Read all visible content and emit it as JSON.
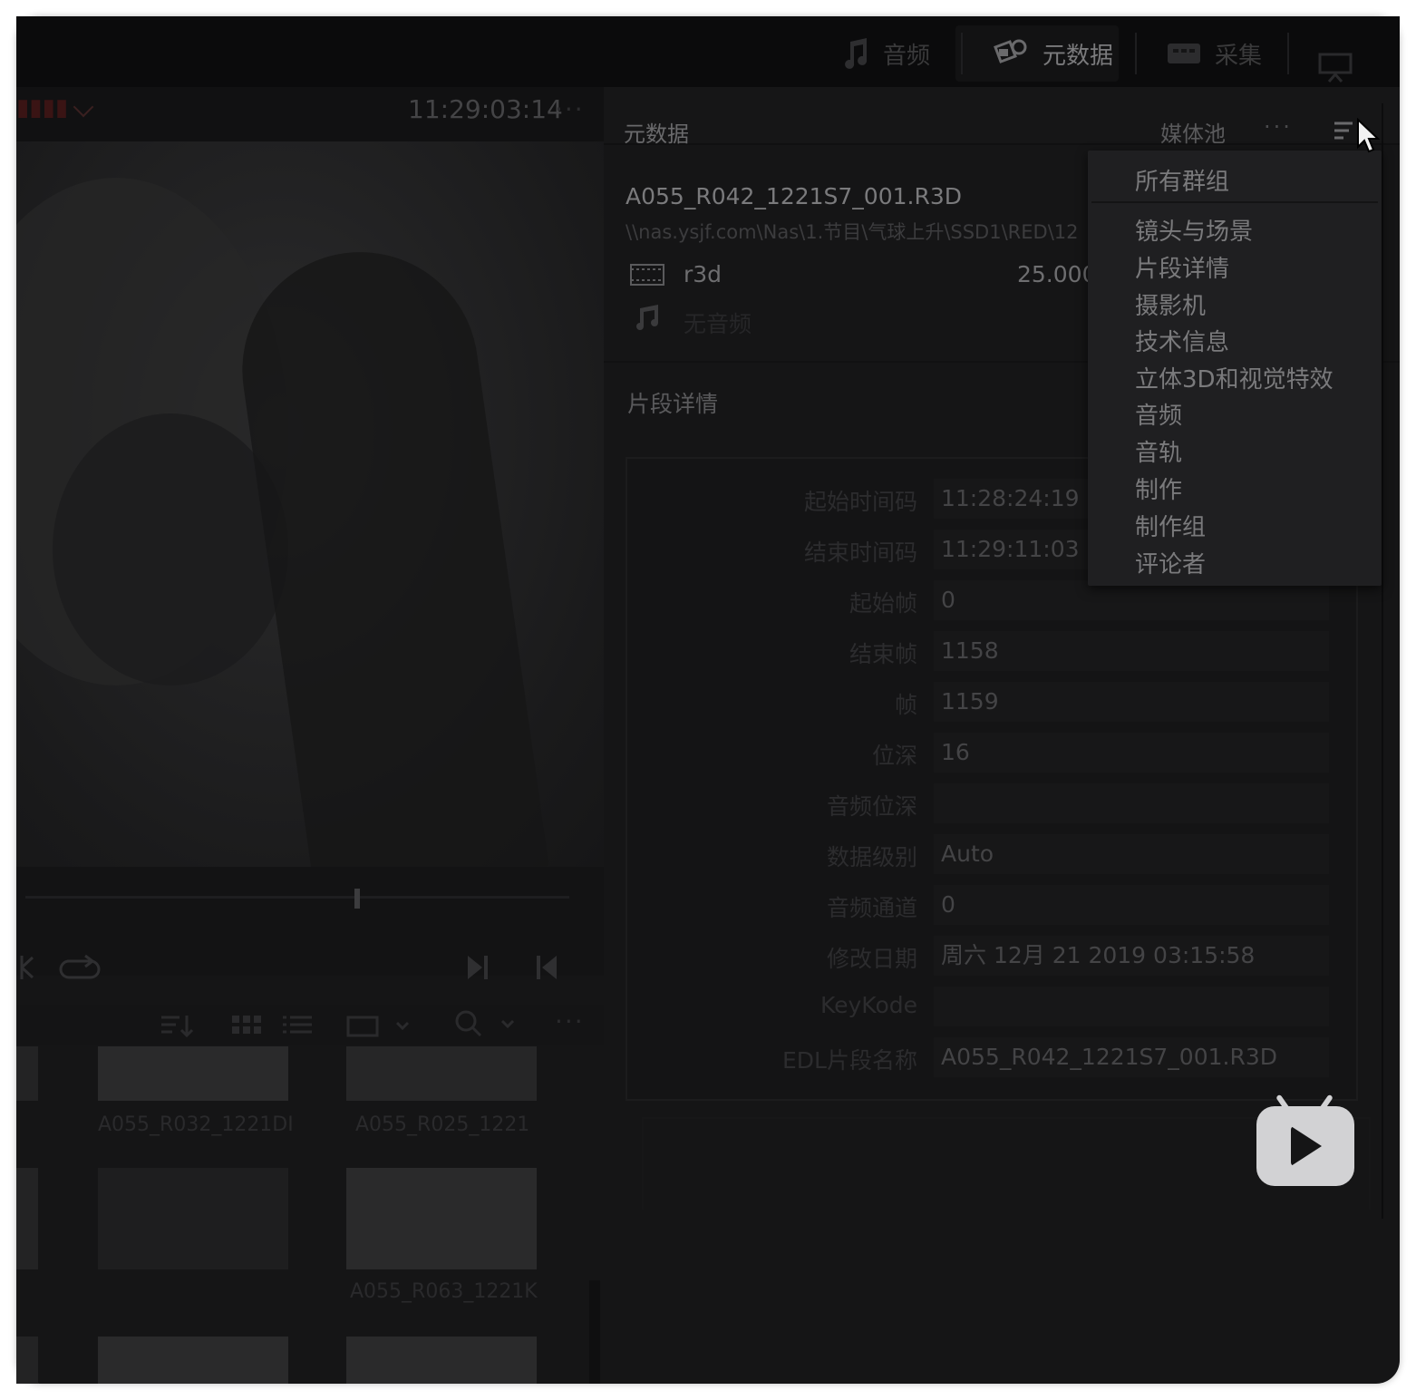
{
  "top_tabs": [
    {
      "label": "音频",
      "icon": "music-note-icon"
    },
    {
      "label": "元数据",
      "icon": "metadata-tags-icon"
    },
    {
      "label": "采集",
      "icon": "capture-icon"
    }
  ],
  "viewer": {
    "timecode": "11:29:03:14",
    "menu": "···"
  },
  "media_pool": {
    "thumb_labels": [
      "A055_R032_1221DI",
      "A055_R025_1221",
      "A055_R063_1221K"
    ]
  },
  "metadata_panel": {
    "title": "元数据",
    "pool_button": "媒体池",
    "more": "···",
    "clip": {
      "name": "A055_R042_1221S7_001.R3D",
      "path": "\\\\nas.ysjf.com\\Nas\\1.节目\\气球上升\\SSD1\\RED\\12",
      "format": "r3d",
      "fps": "25.000",
      "audio": "无音频"
    },
    "section_title": "片段详情",
    "rows": [
      {
        "label": "起始时间码",
        "value": "11:28:24:19"
      },
      {
        "label": "结束时间码",
        "value": "11:29:11:03"
      },
      {
        "label": "起始帧",
        "value": "0"
      },
      {
        "label": "结束帧",
        "value": "1158"
      },
      {
        "label": "帧",
        "value": "1159"
      },
      {
        "label": "位深",
        "value": "16"
      },
      {
        "label": "音频位深",
        "value": ""
      },
      {
        "label": "数据级别",
        "value": "Auto"
      },
      {
        "label": "音频通道",
        "value": "0"
      },
      {
        "label": "修改日期",
        "value": "周六 12月 21 2019 03:15:58"
      },
      {
        "label": "KeyKode",
        "value": ""
      },
      {
        "label": "EDL片段名称",
        "value": "A055_R042_1221S7_001.R3D"
      }
    ]
  },
  "dropdown": {
    "header": "所有群组",
    "items": [
      "镜头与场景",
      "片段详情",
      "摄影机",
      "技术信息",
      "立体3D和视觉特效",
      "音频",
      "音轨",
      "制作",
      "制作组",
      "评论者"
    ]
  },
  "colors": {
    "panel_bg": "#151516",
    "dropdown_bg": "#1f1f21",
    "text_dim": "#444446",
    "badge": "#d2d2d4"
  }
}
